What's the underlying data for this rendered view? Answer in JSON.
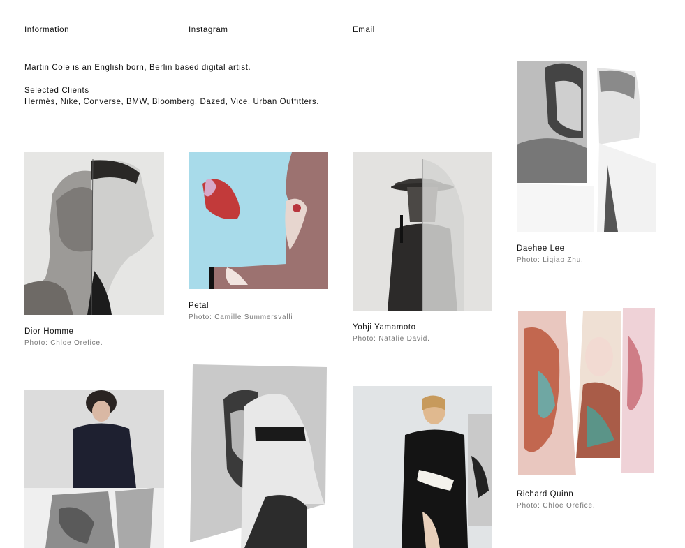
{
  "nav": {
    "information": "Information",
    "instagram": "Instagram",
    "email": "Email"
  },
  "intro": {
    "bio": "Martin Cole is an English born, Berlin based digital artist.",
    "clients_heading": "Selected Clients",
    "clients_list": "Hermés, Nike, Converse, BMW, Bloomberg, Dazed, Vice, Urban Outfitters."
  },
  "projects": [
    {
      "title": "Dior Homme",
      "credit": "Photo: Chloe Orefice.",
      "image": "collage-portrait-profile"
    },
    {
      "title": "Petal",
      "credit": "Photo: Camille Summersvalli",
      "image": "collage-flower-blue"
    },
    {
      "title": "Yohji Yamamoto",
      "credit": "Photo: Natalie David.",
      "image": "collage-hat-portrait"
    },
    {
      "title": "Daehee Lee",
      "credit": "Photo: Liqiao Zhu.",
      "image": "collage-torn-portrait"
    },
    {
      "title": "Richard Quinn",
      "credit": "Photo: Chloe Orefice.",
      "image": "collage-floral-strips"
    },
    {
      "title": "",
      "credit": "",
      "image": "collage-blazer-seated"
    },
    {
      "title": "",
      "credit": "",
      "image": "collage-sunglasses-profile"
    },
    {
      "title": "",
      "credit": "",
      "image": "collage-black-coat"
    }
  ]
}
